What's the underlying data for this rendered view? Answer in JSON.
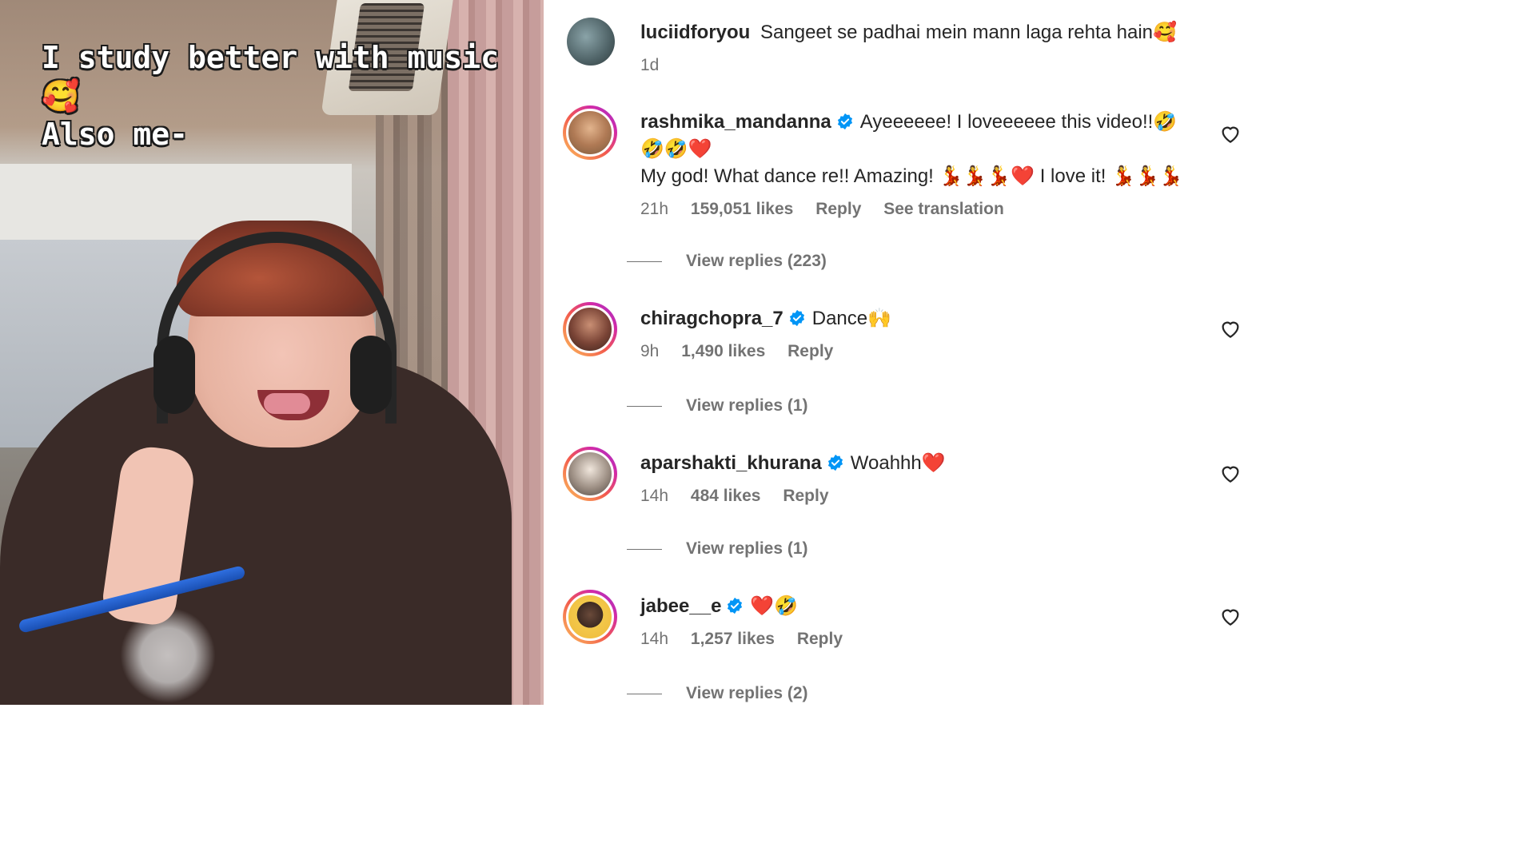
{
  "video": {
    "overlay_lines": [
      "I study better with music",
      "🥰",
      "Also me-"
    ]
  },
  "comments": [
    {
      "username": "luciidforyou",
      "verified": false,
      "text": "Sangeet se padhai mein mann laga rehta hain🥰",
      "time": "1d",
      "likes": "",
      "reply_label": "",
      "see_translation": "",
      "view_replies": ""
    },
    {
      "username": "rashmika_mandanna",
      "verified": true,
      "text": "Ayeeeeee! I loveeeeee this video!!🤣",
      "text2": "🤣🤣❤️",
      "text3": "My god! What dance re!! Amazing! 💃💃💃❤️ I love it! 💃💃💃",
      "time": "21h",
      "likes": "159,051 likes",
      "reply_label": "Reply",
      "see_translation": "See translation",
      "view_replies": "View replies (223)"
    },
    {
      "username": "chiragchopra_7",
      "verified": true,
      "text": "Dance🙌",
      "time": "9h",
      "likes": "1,490 likes",
      "reply_label": "Reply",
      "view_replies": "View replies (1)"
    },
    {
      "username": "aparshakti_khurana",
      "verified": true,
      "text": "Woahhh❤️",
      "time": "14h",
      "likes": "484 likes",
      "reply_label": "Reply",
      "view_replies": "View replies (1)"
    },
    {
      "username": "jabee__e",
      "verified": true,
      "text": "❤️🤣",
      "time": "14h",
      "likes": "1,257 likes",
      "reply_label": "Reply",
      "view_replies": "View replies (2)"
    }
  ],
  "colors": {
    "verified_blue": "#0095f6",
    "meta_gray": "#737373",
    "text": "#262626"
  },
  "icons": [
    "verified-badge-icon",
    "heart-outline-icon"
  ]
}
